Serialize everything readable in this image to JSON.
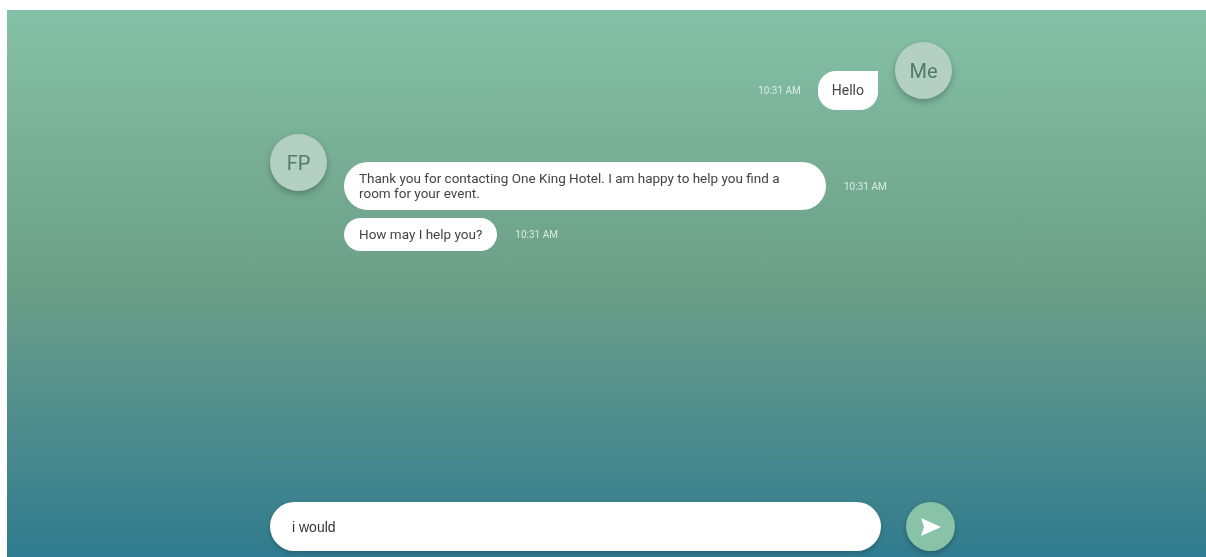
{
  "messages": [
    {
      "kind": "sent",
      "avatar": "Me",
      "text": "Hello",
      "time": "10:31 AM"
    },
    {
      "kind": "received",
      "avatar": "FP",
      "text": "Thank you for contacting One King Hotel. I am happy to help you find a room for your event.",
      "time": "10:31 AM"
    },
    {
      "kind": "received",
      "text": "How may I help you?",
      "time": "10:31 AM"
    }
  ],
  "composer": {
    "value": "i would"
  }
}
